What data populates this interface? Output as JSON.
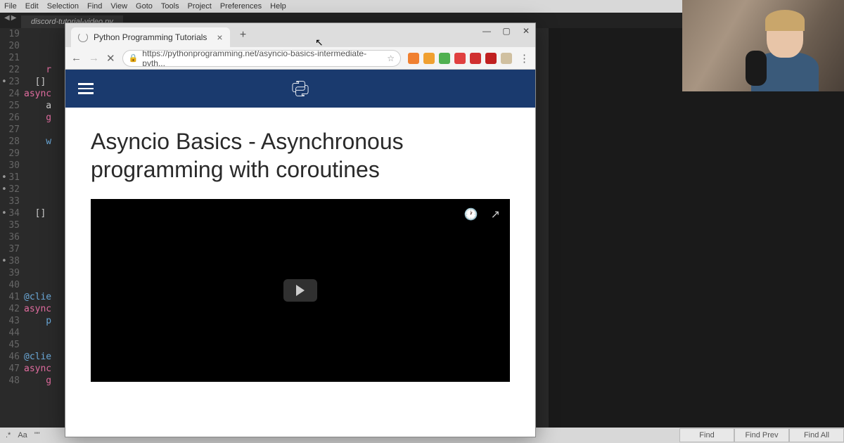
{
  "editor": {
    "menu": [
      "File",
      "Edit",
      "Selection",
      "Find",
      "View",
      "Goto",
      "Tools",
      "Project",
      "Preferences",
      "Help"
    ],
    "tab": "discord-tutorial-video.py",
    "lines": [
      {
        "n": "19"
      },
      {
        "n": "20"
      },
      {
        "n": "21"
      },
      {
        "n": "22",
        "txt": "    r",
        "cls": "kw-r"
      },
      {
        "n": "23",
        "dot": true,
        "txt": "  []"
      },
      {
        "n": "24",
        "txt": "async",
        "cls": "kw-r"
      },
      {
        "n": "25",
        "txt": "    a"
      },
      {
        "n": "26",
        "txt": "    g",
        "cls": "kw-r"
      },
      {
        "n": "27"
      },
      {
        "n": "28",
        "txt": "    w",
        "cls": "kw-b"
      },
      {
        "n": "29"
      },
      {
        "n": "30"
      },
      {
        "n": "31",
        "dot": true
      },
      {
        "n": "32",
        "dot": true
      },
      {
        "n": "33"
      },
      {
        "n": "34",
        "dot": true,
        "txt": "  []"
      },
      {
        "n": "35"
      },
      {
        "n": "36"
      },
      {
        "n": "37"
      },
      {
        "n": "38",
        "dot": true
      },
      {
        "n": "39"
      },
      {
        "n": "40"
      },
      {
        "n": "41",
        "txt": "@clie",
        "cls": "kw-b"
      },
      {
        "n": "42",
        "txt": "async",
        "cls": "kw-r"
      },
      {
        "n": "43",
        "txt": "    p",
        "cls": "kw-b"
      },
      {
        "n": "44"
      },
      {
        "n": "45"
      },
      {
        "n": "46",
        "txt": "@clie",
        "cls": "kw-b"
      },
      {
        "n": "47",
        "txt": "async",
        "cls": "kw-r"
      },
      {
        "n": "48",
        "txt": "    g",
        "cls": "kw-r"
      }
    ],
    "find": {
      "regex": ".*",
      "case": "Aa",
      "word": "\"\"",
      "btn1": "Find",
      "btn2": "Find Prev",
      "btn3": "Find All"
    }
  },
  "browser": {
    "tab_title": "Python Programming Tutorials",
    "url": "https://pythonprogramming.net/asyncio-basics-intermediate-pyth...",
    "page_title": "Asyncio Basics - Asynchronous programming with coroutines",
    "ext_colors": [
      "#f08030",
      "#f0a030",
      "#50b050",
      "#e04040",
      "#d03030",
      "#c02020",
      "#d0c0a0"
    ]
  }
}
